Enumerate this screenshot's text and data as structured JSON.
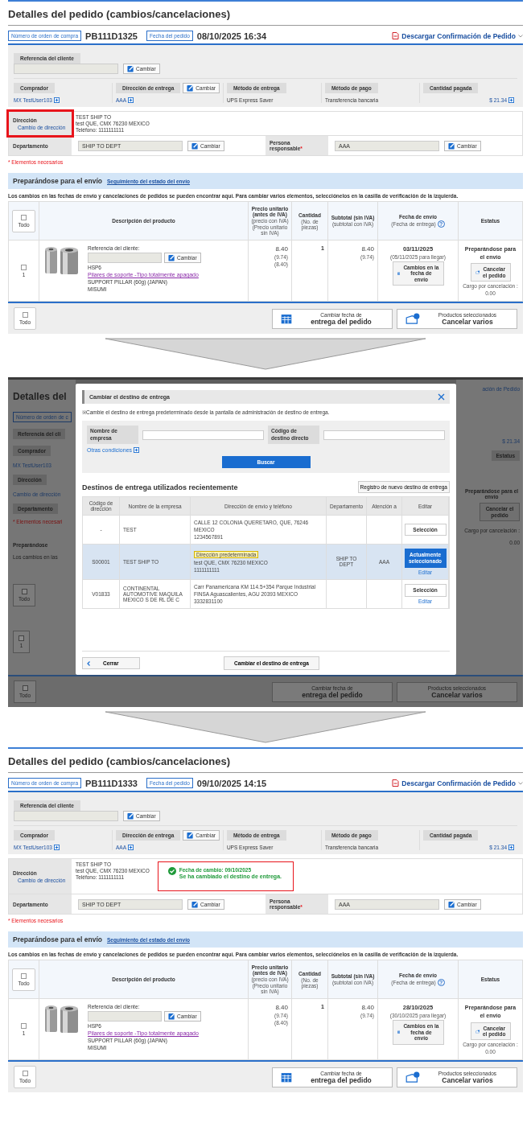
{
  "steps": [
    {
      "kind": "order",
      "title": "Detalles del pedido (cambios/cancelaciones)",
      "po_label": "Número de orden de compra",
      "po_number": "PB111D1325",
      "date_label": "Fecha del pedido",
      "date": "08/10/2025 16:34",
      "download": "Descargar Confirmación de Pedido",
      "customer_ref": {
        "label": "Referencia del cliente",
        "button": "Cambiar"
      },
      "info": [
        {
          "label": "Comprador",
          "value": "MX TestUser103",
          "kind": "link"
        },
        {
          "label": "Dirección de entrega",
          "button": "Cambiar",
          "value": "AAA",
          "kind": "link"
        },
        {
          "label": "Método de entrega",
          "value": "UPS Express Saver",
          "kind": "text"
        },
        {
          "label": "Método de pago",
          "value": "Transferencia bancaria",
          "kind": "text"
        },
        {
          "label": "Cantidad pagada",
          "value": "$ 21.34",
          "kind": "amount"
        }
      ],
      "address": {
        "label": "Dirección",
        "link": "Cambio de dirección",
        "lines": [
          "TEST SHIP TO",
          "test QUE, CMX 76230 MEXICO",
          "Teléfono: 1111111111"
        ],
        "highlighted": true
      },
      "department": {
        "label": "Departamento",
        "value": "SHIP TO DEPT",
        "button": "Cambiar"
      },
      "responsible": {
        "label": "Persona responsable",
        "required_mark": "*",
        "value": "AAA",
        "button": "Cambiar"
      },
      "required_note": "* Elementos necesarios",
      "shipping": {
        "title": "Preparándose para el envío",
        "tracking": "Seguimiento del estado del envío",
        "note": "Los cambios en las fechas de envío y cancelaciones de pedidos se pueden encontrar aquí. Para cambiar varios elementos, selecciónelos en la casilla de verificación de la izquierda.",
        "header_select": {
          "label": "Todo",
          "checked": false
        },
        "columns": [
          {
            "title": "Descripción del producto"
          },
          {
            "title": "Precio unitario (antes de IVA)",
            "subs": [
              "(precio con IVA)",
              "(Precio unitario sin IVA)"
            ]
          },
          {
            "title": "Cantidad",
            "subs": [
              "(No. de piezas)"
            ]
          },
          {
            "title": "Subtotal (sin IVA)",
            "subs": [
              "(subtotal con IVA)"
            ]
          },
          {
            "title": "Fecha de envío",
            "subs": [
              "(Fecha de entrega)"
            ],
            "help": "?"
          },
          {
            "title": "Estatus"
          }
        ],
        "rows": [
          {
            "checked": false,
            "index": "1",
            "ref_label": "Referencia del cliente:",
            "ref_button": "Cambiar",
            "code": "HSP6",
            "name": "Pilares de soporte -Tipo totalmente apagado",
            "desc": "SUPPORT PILLAR (60g) (JAPAN)",
            "maker": "MISUMI",
            "price": "8.40",
            "price_subs": [
              "(9.74)",
              "(8.40)"
            ],
            "qty": "1",
            "subtotal": "8.40",
            "subtotal_sub": "(9.74)",
            "ship_date": "03/11/2025",
            "arrival": "(05/11/2025 para llegar)",
            "date_button": "Cambios en la fecha de envío",
            "status": "Preparándose para el envío",
            "cancel_button": "Cancelar el pedido",
            "fee_label": "Cargo por cancelación :",
            "fee": "0.00"
          }
        ],
        "footer": {
          "select": {
            "label": "Todo",
            "checked": false
          },
          "change_date": [
            "Cambiar fecha de",
            "entrega del pedido"
          ],
          "cancel": [
            "Productos seleccionados",
            "Cancelar varios"
          ]
        }
      }
    },
    {
      "kind": "dialog",
      "backdrop": {
        "left": [
          {
            "kind": "title",
            "text": "Detalles del"
          },
          {
            "kind": "tag",
            "text": "Número de orden de c"
          },
          {
            "kind": "label",
            "text": "Referencia del cli"
          },
          {
            "kind": "label",
            "text": "Comprador"
          },
          {
            "kind": "link",
            "text": "MX TestUser103"
          },
          {
            "kind": "label",
            "text": "Dirección"
          },
          {
            "kind": "link",
            "text": "Cambio de dirección"
          },
          {
            "kind": "label",
            "text": "Departamento"
          },
          {
            "kind": "required",
            "text": "* Elementos necesari"
          },
          {
            "kind": "heading",
            "text": "Preparándose"
          },
          {
            "kind": "text",
            "text": "Los cambios en las"
          },
          {
            "kind": "checkbox",
            "text": "Todo",
            "checked": false
          },
          {
            "kind": "checkbox",
            "text": "1",
            "checked": false
          }
        ],
        "right": [
          {
            "kind": "link",
            "text": "ación de Pedido"
          },
          {
            "kind": "amount",
            "text": "$ 21.34"
          },
          {
            "kind": "label",
            "text": "Estatus"
          },
          {
            "kind": "status",
            "text": "Preparándose para el envío"
          },
          {
            "kind": "button",
            "text": "Cancelar el pedido"
          },
          {
            "kind": "text",
            "text": "Cargo por cancelación :"
          },
          {
            "kind": "text",
            "text": "0.00"
          }
        ],
        "footer": {
          "select": {
            "label": "Todo",
            "checked": false
          },
          "change_date": [
            "Cambiar fecha de",
            "entrega del pedido"
          ],
          "cancel": [
            "Productos seleccionados",
            "Cancelar varios"
          ]
        }
      },
      "modal": {
        "title": "Cambiar el destino de entrega",
        "note": "※Cambie el destino de entrega predeterminado desde la pantalla de administración de destino de entrega.",
        "fields": [
          {
            "label": "Nombre de empresa"
          },
          {
            "label": "Código de destino directo"
          }
        ],
        "more": "Otras condiciones",
        "search": "Buscar",
        "heading": "Destinos de entrega utilizados recientemente",
        "register": "Registro de nuevo destino de entrega",
        "columns": [
          "Código de dirección",
          "Nombre de la empresa",
          "Dirección de envío y teléfono",
          "Departamento",
          "Atención a",
          "Editar"
        ],
        "rows": [
          {
            "code": "-",
            "company": "TEST",
            "address": [
              "CALLE 12 COLONIA QUERETARO, QUE, 76246",
              "MEXICO",
              "1234567891"
            ],
            "selected": false,
            "select_label": "Selección"
          },
          {
            "code": "S00001",
            "company": "TEST SHIP TO",
            "default_tag": "Dirección predeterminada",
            "address": [
              "test QUE, CMX 76230 MEXICO",
              "1111111111"
            ],
            "department": "SHIP TO DEPT",
            "attention": "AAA",
            "selected": true,
            "select_label": "Actualmente seleccionado",
            "edit": "Editar"
          },
          {
            "code": "V01833",
            "company": "CONTINENTAL AUTOMOTIVE MAQUILA MEXICO S DE RL DE C",
            "address": [
              "Carr Panamericana KM 114.5+354 Parque Industrial",
              "FINSA Aguascalientes, AGU 20393 MEXICO",
              "3332831100"
            ],
            "selected": false,
            "select_label": "Selección",
            "edit": "Editar"
          }
        ],
        "close": "Cerrar",
        "confirm": "Cambiar el destino de entrega"
      }
    },
    {
      "kind": "order",
      "title": "Detalles del pedido (cambios/cancelaciones)",
      "po_label": "Número de orden de compra",
      "po_number": "PB111D1333",
      "date_label": "Fecha del pedido",
      "date": "09/10/2025 14:15",
      "download": "Descargar Confirmación de Pedido",
      "customer_ref": {
        "label": "Referencia del cliente",
        "button": "Cambiar"
      },
      "info": [
        {
          "label": "Comprador",
          "value": "MX TestUser103",
          "kind": "link"
        },
        {
          "label": "Dirección de entrega",
          "button": "Cambiar",
          "value": "AAA",
          "kind": "link"
        },
        {
          "label": "Método de entrega",
          "value": "UPS Express Saver",
          "kind": "text"
        },
        {
          "label": "Método de pago",
          "value": "Transferencia bancaria",
          "kind": "text"
        },
        {
          "label": "Cantidad pagada",
          "value": "$ 21.34",
          "kind": "amount"
        }
      ],
      "address": {
        "label": "Dirección",
        "link": "Cambio de dirección",
        "lines": [
          "TEST SHIP TO",
          "test QUE, CMX 76230 MEXICO",
          "Teléfono: 1111111111"
        ],
        "highlighted": false
      },
      "notice": {
        "date": "Fecha de cambio: 09/10/2025",
        "message": "Se ha cambiado el destino de entrega."
      },
      "department": {
        "label": "Departamento",
        "value": "SHIP TO DEPT",
        "button": "Cambiar"
      },
      "responsible": {
        "label": "Persona responsable",
        "required_mark": "*",
        "value": "AAA",
        "button": "Cambiar"
      },
      "required_note": "* Elementos necesarios",
      "shipping": {
        "title": "Preparándose para el envío",
        "tracking": "Seguimiento del estado del envío",
        "note": "Los cambios en las fechas de envío y cancelaciones de pedidos se pueden encontrar aquí. Para cambiar varios elementos, selecciónelos en la casilla de verificación de la izquierda.",
        "header_select": {
          "label": "Todo",
          "checked": false
        },
        "columns": [
          {
            "title": "Descripción del producto"
          },
          {
            "title": "Precio unitario (antes de IVA)",
            "subs": [
              "(precio con IVA)",
              "(Precio unitario sin IVA)"
            ]
          },
          {
            "title": "Cantidad",
            "subs": [
              "(No. de piezas)"
            ]
          },
          {
            "title": "Subtotal (sin IVA)",
            "subs": [
              "(subtotal con IVA)"
            ]
          },
          {
            "title": "Fecha de envío",
            "subs": [
              "(Fecha de entrega)"
            ],
            "help": "?"
          },
          {
            "title": "Estatus"
          }
        ],
        "rows": [
          {
            "checked": false,
            "index": "1",
            "ref_label": "Referencia del cliente:",
            "ref_button": "Cambiar",
            "code": "HSP6",
            "name": "Pilares de soporte -Tipo totalmente apagado",
            "desc": "SUPPORT PILLAR (60g) (JAPAN)",
            "maker": "MISUMI",
            "price": "8.40",
            "price_subs": [
              "(9.74)",
              "(8.40)"
            ],
            "qty": "1",
            "subtotal": "8.40",
            "subtotal_sub": "(9.74)",
            "ship_date": "28/10/2025",
            "arrival": "(30/10/2025 para llegar)",
            "date_button": "Cambios en la fecha de envío",
            "status": "Preparándose para el envío",
            "cancel_button": "Cancelar el pedido",
            "fee_label": "Cargo por cancelación :",
            "fee": "0.00"
          }
        ],
        "footer": {
          "select": {
            "label": "Todo",
            "checked": false
          },
          "change_date": [
            "Cambiar fecha de",
            "entrega del pedido"
          ],
          "cancel": [
            "Productos seleccionados",
            "Cancelar varios"
          ]
        }
      }
    }
  ]
}
